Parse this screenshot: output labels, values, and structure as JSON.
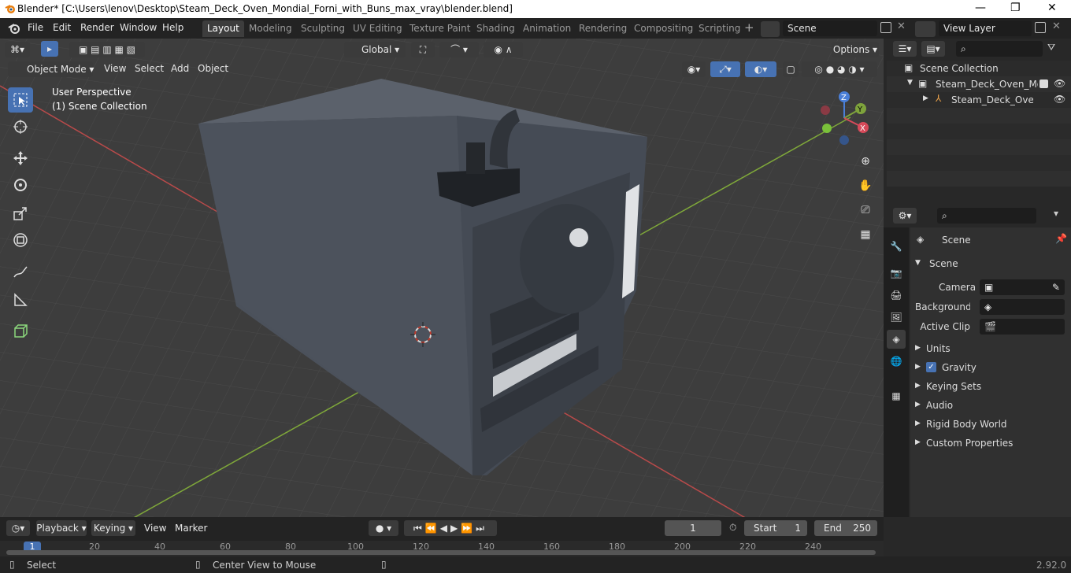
{
  "window": {
    "title": "Blender* [C:\\Users\\lenov\\Desktop\\Steam_Deck_Oven_Mondial_Forni_with_Buns_max_vray\\blender.blend]",
    "minimize": "—",
    "maximize": "❐",
    "close": "✕"
  },
  "menu": {
    "file": "File",
    "edit": "Edit",
    "render": "Render",
    "window": "Window",
    "help": "Help"
  },
  "workspaces": [
    "Layout",
    "Modeling",
    "Sculpting",
    "UV Editing",
    "Texture Paint",
    "Shading",
    "Animation",
    "Rendering",
    "Compositing",
    "Scripting"
  ],
  "scene_field": "Scene",
  "view_layer_field": "View Layer",
  "viewport_header": {
    "transform_orientation": "Global",
    "options": "Options",
    "mode": "Object Mode",
    "view": "View",
    "select": "Select",
    "add": "Add",
    "object": "Object"
  },
  "viewport_overlay": {
    "perspective": "User Perspective",
    "collection": "(1) Scene Collection"
  },
  "gizmo": {
    "z": "Z",
    "y": "Y",
    "x": "X"
  },
  "outliner": {
    "root": "Scene Collection",
    "collection": "Steam_Deck_Oven_Mon",
    "object": "Steam_Deck_Oven_I"
  },
  "properties": {
    "header": "Scene",
    "panel": "Scene",
    "camera_label": "Camera",
    "background_label": "Background ...",
    "active_clip_label": "Active Clip",
    "sections": [
      "Units",
      "Gravity",
      "Keying Sets",
      "Audio",
      "Rigid Body World",
      "Custom Properties"
    ],
    "gravity_checked": true
  },
  "timeline": {
    "playback": "Playback",
    "keying": "Keying",
    "view": "View",
    "marker": "Marker",
    "current_frame": "1",
    "start_label": "Start",
    "start_value": "1",
    "end_label": "End",
    "end_value": "250",
    "ruler_current": "1",
    "ruler_ticks": [
      "20",
      "40",
      "60",
      "80",
      "100",
      "120",
      "140",
      "160",
      "180",
      "200",
      "220",
      "240"
    ]
  },
  "status": {
    "select": "Select",
    "center": "Center View to Mouse",
    "version": "2.92.0"
  },
  "colors": {
    "accent": "#4772b3",
    "viewport_bg": "#3d3d3d",
    "panel_bg": "#282828",
    "oven": "#4f5560"
  }
}
